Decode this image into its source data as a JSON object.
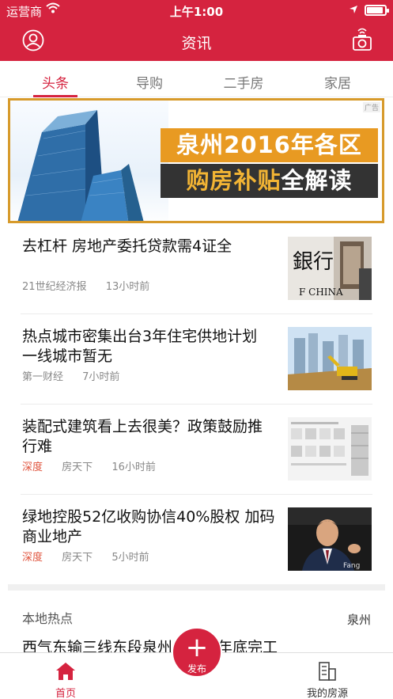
{
  "status_bar": {
    "carrier": "运营商",
    "time": "上午1:00"
  },
  "header": {
    "title": "资讯"
  },
  "tabs": [
    {
      "label": "头条",
      "active": true
    },
    {
      "label": "导购",
      "active": false
    },
    {
      "label": "二手房",
      "active": false
    },
    {
      "label": "家居",
      "active": false
    }
  ],
  "banner": {
    "ad_tag": "广告",
    "line1": "泉州2016年各区",
    "line2_highlight": "购房补贴",
    "line2_rest": "全解读"
  },
  "news": [
    {
      "title": "去杠杆 房地产委托贷款需4证全",
      "tag": "",
      "source": "21世纪经济报",
      "time": "13小时前",
      "thumb": "bank-china-sign"
    },
    {
      "title": "热点城市密集出台3年住宅供地计划 一线城市暂无",
      "tag": "",
      "source": "第一财经",
      "time": "7小时前",
      "thumb": "construction-site-excavator"
    },
    {
      "title": "装配式建筑看上去很美？政策鼓励推行难",
      "tag": "深度",
      "source": "房天下",
      "time": "16小时前",
      "thumb": "prefab-building-diagram"
    },
    {
      "title": "绿地控股52亿收购协信40%股权 加码商业地产",
      "tag": "深度",
      "source": "房天下",
      "time": "5小时前",
      "thumb": "speaker-portrait"
    }
  ],
  "local": {
    "title": "本地热点",
    "city": "泉州",
    "first_headline": "西气东输三线东段泉州段或于年底完工"
  },
  "bottom_nav": {
    "home": "首页",
    "publish": "发布",
    "mine": "我的房源"
  },
  "colors": {
    "brand": "#d5233f",
    "tag": "#e0553f",
    "banner_orange": "#e89a22"
  }
}
